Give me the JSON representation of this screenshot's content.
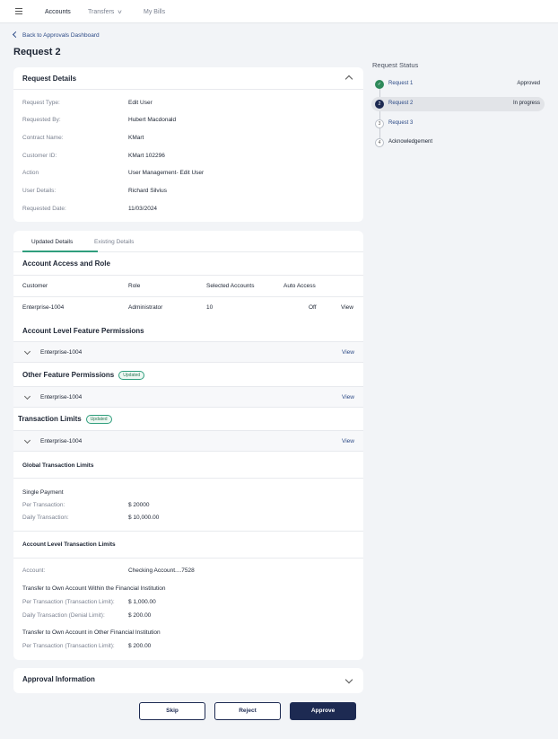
{
  "nav": {
    "items": [
      "Accounts",
      "Transfers",
      "My Bills"
    ],
    "back_label": "Back to Approvals Dashboard"
  },
  "page": {
    "title": "Request 2"
  },
  "request_details": {
    "title": "Request Details",
    "rows": [
      {
        "label": "Request Type:",
        "value": "Edit User"
      },
      {
        "label": "Requested By:",
        "value": "Hubert Macdonald"
      },
      {
        "label": "Contract Name:",
        "value": "KMart"
      },
      {
        "label": "Customer ID:",
        "value": "KMart 102296"
      },
      {
        "label": "Action",
        "value": "User Management- Edit User"
      },
      {
        "label": "User Details:",
        "value": "Richard Silvius"
      },
      {
        "label": "Requested Date:",
        "value": "11/03/2024"
      }
    ]
  },
  "details": {
    "tabs": [
      "Updated Details",
      "Existing Details"
    ],
    "access_title": "Account Access and Role",
    "columns": [
      "Customer",
      "Role",
      "Selected Accounts",
      "Auto Access"
    ],
    "row": {
      "customer": "Enterprise-1004",
      "role": "Administrator",
      "selected": "10",
      "auto": "Off",
      "view": "View"
    },
    "account_feature_title": "Account Level Feature Permissions",
    "other_feature_title": "Other Feature Permissions",
    "transaction_title": "Transaction Limits",
    "badge": "Updated",
    "enterprise": "Enterprise-1004",
    "view": "View",
    "global_title": "Global Transaction Limits",
    "single_payment": "Single Payment",
    "per_transaction_label": "Per Transaction:",
    "per_transaction_value": "$ 20000",
    "daily_transaction_label": "Daily Transaction:",
    "daily_transaction_value": "$ 10,000.00",
    "account_limits_title": "Account Level Transaction Limits",
    "account_label": "Account:",
    "account_value": "Checking Account....7528",
    "own_within": "Transfer to Own Account Within the Financial Institution",
    "per_tx_limit_label": "Per Transaction (Transaction Limit):",
    "per_tx_limit_value": "$ 1,000.00",
    "daily_denial_label": "Daily Transaction (Denial Limit):",
    "daily_denial_value": "$ 200.00",
    "own_other": "Transfer to Own Account in Other Financial Institution",
    "per_tx_limit_label2": "Per Transaction  (Transaction Limit):",
    "per_tx_limit_value2": "$ 200.00"
  },
  "approval": {
    "title": "Approval Information"
  },
  "status": {
    "title": "Request Status",
    "steps": [
      {
        "num": "✓",
        "label": "Request 1",
        "status": "Approved"
      },
      {
        "num": "2",
        "label": "Request 2",
        "status": "In progress"
      },
      {
        "num": "3",
        "label": "Request 3",
        "status": ""
      },
      {
        "num": "4",
        "label": "Acknowledgement",
        "status": ""
      }
    ]
  },
  "actions": {
    "skip": "Skip",
    "reject": "Reject",
    "approve": "Approve"
  },
  "colors": {
    "primary": "#1d2a52",
    "accent": "#2f9e7d",
    "link": "#2c4a86"
  }
}
